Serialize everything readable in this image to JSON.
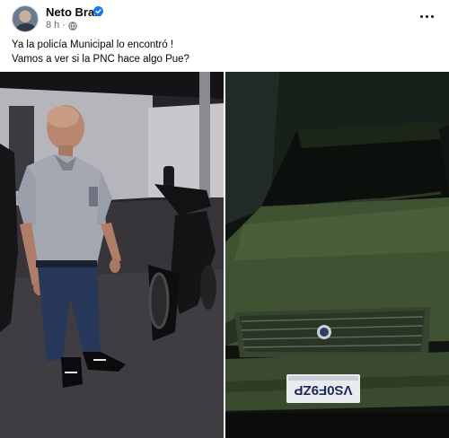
{
  "post": {
    "author": "Neto Bran",
    "timestamp": "8 h",
    "text_lines": [
      "Ya la policía Municipal lo encontró !",
      "Vamos a ver si la PNC hace algo Pue?"
    ]
  },
  "photos": {
    "left": {
      "subject": "man-standing-next-to-motorcycle"
    },
    "right": {
      "subject": "green-car-front",
      "plate_text": "VS0F9ZP"
    }
  },
  "icons": {
    "verified": "verified-badge-icon",
    "audience": "globe-icon",
    "more": "more-options-icon"
  },
  "colors": {
    "verified": "#1877f2",
    "meta_text": "#65676b",
    "car_green": "#3f5231"
  }
}
